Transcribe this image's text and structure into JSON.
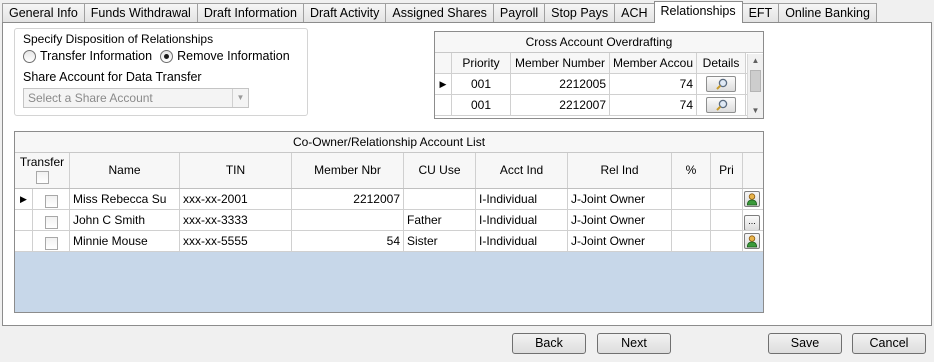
{
  "tabs": [
    {
      "label": "General Info"
    },
    {
      "label": "Funds Withdrawal"
    },
    {
      "label": "Draft Information"
    },
    {
      "label": "Draft Activity"
    },
    {
      "label": "Assigned Shares"
    },
    {
      "label": "Payroll"
    },
    {
      "label": "Stop Pays"
    },
    {
      "label": "ACH"
    },
    {
      "label": "Relationships",
      "active": true
    },
    {
      "label": "EFT"
    },
    {
      "label": "Online Banking"
    }
  ],
  "disposition": {
    "title": "Specify Disposition of Relationships",
    "options": [
      {
        "label": "Transfer Information",
        "selected": false
      },
      {
        "label": "Remove Information",
        "selected": true
      }
    ],
    "share_label": "Share Account for Data Transfer",
    "share_placeholder": "Select a Share Account"
  },
  "cross_account": {
    "title": "Cross Account Overdrafting",
    "columns": [
      "Priority",
      "Member Number",
      "Member Accou",
      "Details"
    ],
    "rows": [
      {
        "priority": "001",
        "member_number": "2212005",
        "member_account": "74"
      },
      {
        "priority": "001",
        "member_number": "2212007",
        "member_account": "74"
      }
    ]
  },
  "coowner": {
    "title": "Co-Owner/Relationship Account List",
    "columns": [
      "Transfer",
      "Name",
      "TIN",
      "Member Nbr",
      "CU Use",
      "Acct Ind",
      "Rel Ind",
      "%",
      "Pri"
    ],
    "rows": [
      {
        "name": "Miss Rebecca Su",
        "tin": "xxx-xx-2001",
        "member_nbr": "2212007",
        "cu_use": "",
        "acct_ind": "I-Individual",
        "rel_ind": "J-Joint Owner",
        "pct": "",
        "pri": "",
        "action": "person"
      },
      {
        "name": "John C Smith",
        "tin": "xxx-xx-3333",
        "member_nbr": "",
        "cu_use": "Father",
        "acct_ind": "I-Individual",
        "rel_ind": "J-Joint Owner",
        "pct": "",
        "pri": "",
        "action": "..."
      },
      {
        "name": "Minnie Mouse",
        "tin": "xxx-xx-5555",
        "member_nbr": "54",
        "cu_use": "Sister",
        "acct_ind": "I-Individual",
        "rel_ind": "J-Joint Owner",
        "pct": "",
        "pri": "",
        "action": "person"
      }
    ]
  },
  "buttons": {
    "back": "Back",
    "next": "Next",
    "save": "Save",
    "cancel": "Cancel"
  }
}
